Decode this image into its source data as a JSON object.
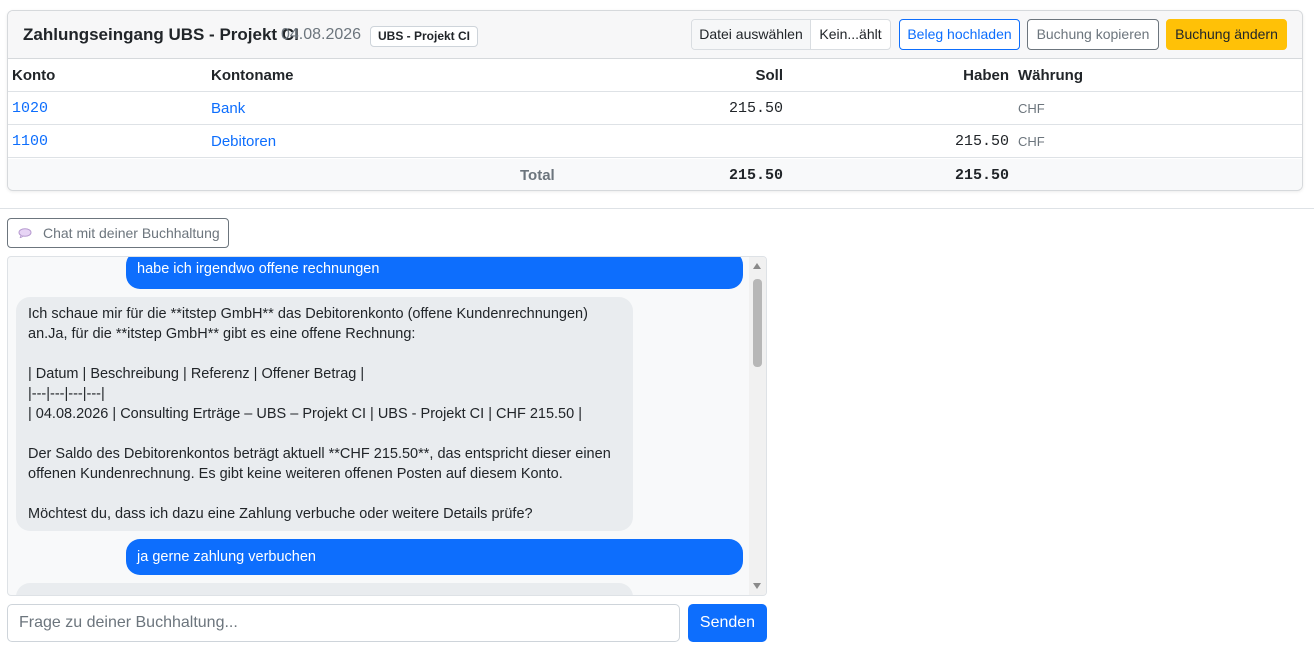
{
  "header": {
    "title": "Zahlungseingang UBS - Projekt CI",
    "date": "04.08.2026",
    "badge": "UBS - Projekt CI",
    "file_button": "Datei auswählen",
    "file_name": "Kein...ählt",
    "upload_label": "Beleg hochladen",
    "copy_label": "Buchung kopieren",
    "edit_label": "Buchung ändern"
  },
  "table": {
    "columns": [
      "Konto",
      "Kontoname",
      "Soll",
      "Haben",
      "Währung"
    ],
    "rows": [
      {
        "konto": "1020",
        "name": "Bank",
        "soll": "215.50",
        "haben": "",
        "currency": "CHF"
      },
      {
        "konto": "1100",
        "name": "Debitoren",
        "soll": "",
        "haben": "215.50",
        "currency": "CHF"
      }
    ],
    "total": {
      "label": "Total",
      "soll": "215.50",
      "haben": "215.50"
    }
  },
  "chat": {
    "toggle_label": "Chat mit deiner Buchhaltung",
    "messages": [
      {
        "role": "user",
        "text": "habe ich irgendwo offene rechnungen"
      },
      {
        "role": "assistant",
        "text": "Ich schaue mir für die **itstep GmbH** das Debitorenkonto (offene Kundenrechnungen) an.Ja, für die **itstep GmbH** gibt es eine offene Rechnung:\n\n| Datum | Beschreibung | Referenz | Offener Betrag |\n|---|---|---|---|\n| 04.08.2026 | Consulting Erträge – UBS – Projekt CI | UBS - Projekt CI | CHF 215.50 |\n\nDer Saldo des Debitorenkontos beträgt aktuell **CHF 215.50**, das entspricht dieser einen offenen Kundenrechnung. Es gibt keine weiteren offenen Posten auf diesem Konto.\n\nMöchtest du, dass ich dazu eine Zahlung verbuche oder weitere Details prüfe?"
      },
      {
        "role": "user",
        "text": "ja gerne zahlung verbuchen"
      }
    ],
    "input_placeholder": "Frage zu deiner Buchhaltung...",
    "send_label": "Senden"
  },
  "colors": {
    "primary": "#0d6efd",
    "warning": "#ffc107",
    "secondary": "#6c757d",
    "bot_bubble": "#e9ecef"
  }
}
